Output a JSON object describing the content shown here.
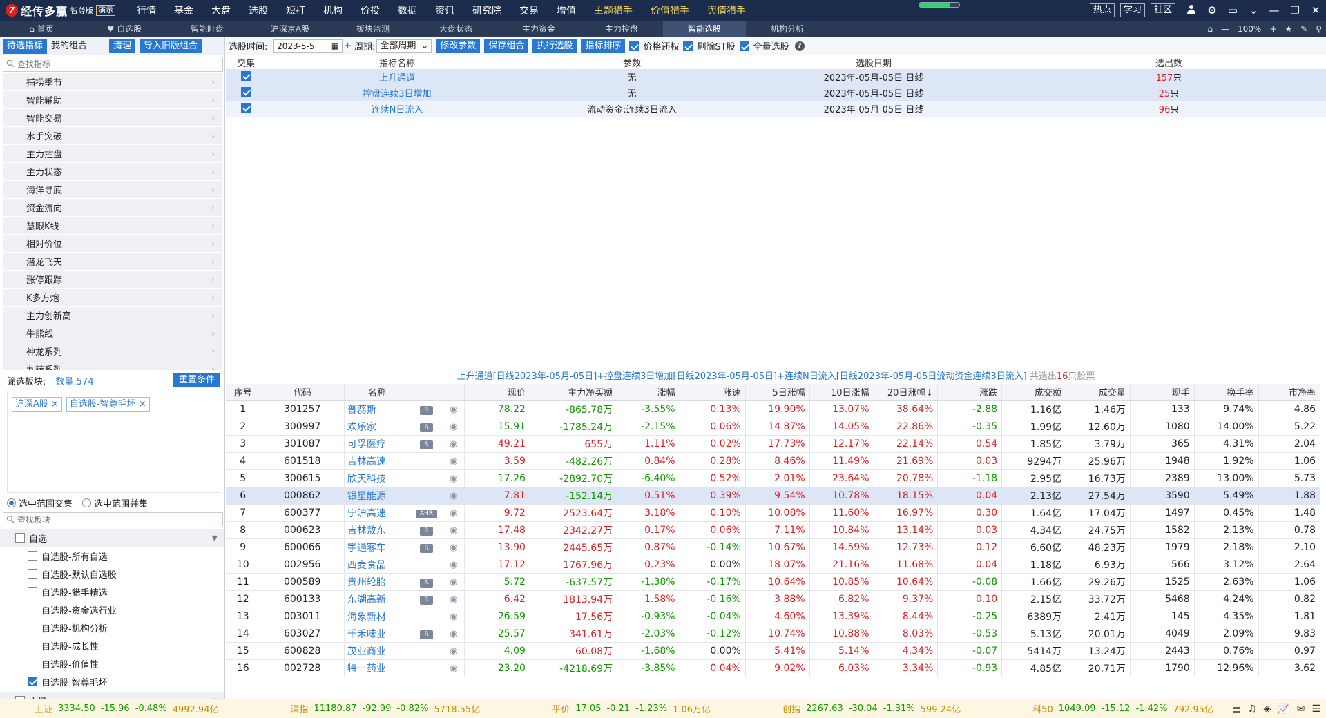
{
  "app": {
    "logo_mark": "7",
    "name": "经传多赢",
    "edition": "智尊版",
    "demo": "演示",
    "download_progress": 0.75
  },
  "menu": [
    "行情",
    "基金",
    "大盘",
    "选股",
    "短打",
    "机构",
    "价投",
    "数据",
    "资讯",
    "研究院",
    "交易",
    "增值"
  ],
  "menu_gold": [
    "主题猎手",
    "价值猎手",
    "舆情猎手"
  ],
  "top_right": {
    "hot": "热点",
    "learn": "学习",
    "community": "社区"
  },
  "tabs": [
    {
      "label": "首页",
      "icon": "home-icon"
    },
    {
      "label": "自选股",
      "icon": "heart-icon"
    },
    {
      "label": "智能盯盘"
    },
    {
      "label": "沪深京A股"
    },
    {
      "label": "板块监测"
    },
    {
      "label": "大盘状态"
    },
    {
      "label": "主力资金"
    },
    {
      "label": "主力控盘"
    },
    {
      "label": "智能选股",
      "active": true
    },
    {
      "label": "机构分析"
    }
  ],
  "tab_right": {
    "zoom": "100%"
  },
  "left": {
    "tab_pending": "待选指标",
    "tab_mine": "我的组合",
    "btn_clear": "清理",
    "btn_import": "导入旧版组合",
    "search_placeholder": "查找指标",
    "indicators": [
      "捕捞季节",
      "智能辅助",
      "智能交易",
      "水手突破",
      "主力控盘",
      "主力状态",
      "海洋寻底",
      "资金流向",
      "慧眼K线",
      "相对价位",
      "潜龙飞天",
      "涨停跟踪",
      "K多方炮",
      "主力创新高",
      "牛熊线",
      "神龙系列",
      "九转系列"
    ],
    "filter_label": "筛选板块:",
    "filter_count": "数量:574",
    "reset_btn": "重置条件",
    "chips": [
      "沪深A股",
      "自选股-智尊毛坯"
    ],
    "radio_intersect": "选中范围交集",
    "radio_union": "选中范围并集",
    "sector_search_placeholder": "查找板块",
    "group_self": "自选",
    "self_items": [
      {
        "label": "自选股-所有自选",
        "checked": false
      },
      {
        "label": "自选股-默认自选股",
        "checked": false
      },
      {
        "label": "自选股-猎手精选",
        "checked": false
      },
      {
        "label": "自选股-资金选行业",
        "checked": false
      },
      {
        "label": "自选股-机构分析",
        "checked": false
      },
      {
        "label": "自选股-成长性",
        "checked": false
      },
      {
        "label": "自选股-价值性",
        "checked": false
      },
      {
        "label": "自选股-智尊毛坯",
        "checked": true
      }
    ],
    "group_market": "市场"
  },
  "toolbar": {
    "time_label": "选股时间:",
    "minus": "-",
    "date": "2023-5-5",
    "plus": "+",
    "period_label": "周期:",
    "period": "全部周期",
    "btn_modify": "修改参数",
    "btn_save": "保存组合",
    "btn_exec": "执行选股",
    "btn_sort": "指标排序",
    "cb_price": "价格还权",
    "cb_st": "剔除ST股",
    "cb_full": "全量选股"
  },
  "ind_table": {
    "headers": [
      "交集",
      "指标名称",
      "参数",
      "选股日期",
      "选出数"
    ],
    "unit": "只",
    "rows": [
      {
        "name": "上升通道",
        "param": "无",
        "date": "2023年-05月-05日 日线",
        "count": "157"
      },
      {
        "name": "控盘连续3日增加",
        "param": "无",
        "date": "2023年-05月-05日 日线",
        "count": "25"
      },
      {
        "name": "连续N日流入",
        "param": "流动资金:连续3日流入",
        "date": "2023年-05月-05日 日线",
        "count": "96"
      }
    ]
  },
  "summary": {
    "text": "上升通道[日线2023年-05月-05日]+控盘连续3日增加[日线2023年-05月-05日]+连续N日流入[日线2023年-05月-05日流动资金连续3日流入]",
    "prefix": "共选出",
    "count": "16",
    "suffix": "只股票"
  },
  "stock_table": {
    "headers": [
      "序号",
      "代码",
      "名称",
      "",
      "",
      "现价",
      "主力净买额",
      "涨幅",
      "涨速",
      "5日涨幅",
      "10日涨幅",
      "20日涨幅↓",
      "涨跌",
      "成交额",
      "成交量",
      "现手",
      "换手率",
      "市净率"
    ],
    "rows": [
      {
        "n": "1",
        "code": "301257",
        "name": "普蕊斯",
        "tag": "R",
        "price": "78.22",
        "net": "-865.78万",
        "chg": "-3.55%",
        "spd": "0.13%",
        "d5": "19.90%",
        "d10": "13.07%",
        "d20": "38.64%",
        "diff": "-2.88",
        "amt": "1.16亿",
        "vol": "1.46万",
        "hand": "133",
        "turn": "9.74%",
        "pb": "4.86"
      },
      {
        "n": "2",
        "code": "300997",
        "name": "欢乐家",
        "tag": "R",
        "price": "15.91",
        "net": "-1785.24万",
        "chg": "-2.15%",
        "spd": "0.06%",
        "d5": "14.87%",
        "d10": "14.05%",
        "d20": "22.86%",
        "diff": "-0.35",
        "amt": "1.99亿",
        "vol": "12.60万",
        "hand": "1080",
        "turn": "14.00%",
        "pb": "5.22"
      },
      {
        "n": "3",
        "code": "301087",
        "name": "可孚医疗",
        "tag": "R",
        "price": "49.21",
        "net": "655万",
        "chg": "1.11%",
        "spd": "0.02%",
        "d5": "17.73%",
        "d10": "12.17%",
        "d20": "22.14%",
        "diff": "0.54",
        "amt": "1.85亿",
        "vol": "3.79万",
        "hand": "365",
        "turn": "4.31%",
        "pb": "2.04"
      },
      {
        "n": "4",
        "code": "601518",
        "name": "吉林高速",
        "tag": "",
        "price": "3.59",
        "net": "-482.26万",
        "chg": "0.84%",
        "spd": "0.28%",
        "d5": "8.46%",
        "d10": "11.49%",
        "d20": "21.69%",
        "diff": "0.03",
        "amt": "9294万",
        "vol": "25.96万",
        "hand": "1948",
        "turn": "1.92%",
        "pb": "1.06"
      },
      {
        "n": "5",
        "code": "300615",
        "name": "欣天科技",
        "tag": "",
        "price": "17.26",
        "net": "-2892.70万",
        "chg": "-6.40%",
        "spd": "0.52%",
        "d5": "2.01%",
        "d10": "23.64%",
        "d20": "20.78%",
        "diff": "-1.18",
        "amt": "2.95亿",
        "vol": "16.73万",
        "hand": "2389",
        "turn": "13.00%",
        "pb": "5.73"
      },
      {
        "n": "6",
        "code": "000862",
        "name": "银星能源",
        "tag": "",
        "price": "7.81",
        "net": "-152.14万",
        "chg": "0.51%",
        "spd": "0.39%",
        "d5": "9.54%",
        "d10": "10.78%",
        "d20": "18.15%",
        "diff": "0.04",
        "amt": "2.13亿",
        "vol": "27.54万",
        "hand": "3590",
        "turn": "5.49%",
        "pb": "1.88",
        "hl": true
      },
      {
        "n": "7",
        "code": "600377",
        "name": "宁沪高速",
        "tag": "AHR",
        "price": "9.72",
        "net": "2523.64万",
        "chg": "3.18%",
        "spd": "0.10%",
        "d5": "10.08%",
        "d10": "11.60%",
        "d20": "16.97%",
        "diff": "0.30",
        "amt": "1.64亿",
        "vol": "17.04万",
        "hand": "1497",
        "turn": "0.45%",
        "pb": "1.48"
      },
      {
        "n": "8",
        "code": "000623",
        "name": "吉林敖东",
        "tag": "R",
        "price": "17.48",
        "net": "2342.27万",
        "chg": "0.17%",
        "spd": "0.06%",
        "d5": "7.11%",
        "d10": "10.84%",
        "d20": "13.14%",
        "diff": "0.03",
        "amt": "4.34亿",
        "vol": "24.75万",
        "hand": "1582",
        "turn": "2.13%",
        "pb": "0.78"
      },
      {
        "n": "9",
        "code": "600066",
        "name": "宇通客车",
        "tag": "R",
        "price": "13.90",
        "net": "2445.65万",
        "chg": "0.87%",
        "spd": "-0.14%",
        "d5": "10.67%",
        "d10": "14.59%",
        "d20": "12.73%",
        "diff": "0.12",
        "amt": "6.60亿",
        "vol": "48.23万",
        "hand": "1979",
        "turn": "2.18%",
        "pb": "2.10"
      },
      {
        "n": "10",
        "code": "002956",
        "name": "西麦食品",
        "tag": "",
        "price": "17.12",
        "net": "1767.96万",
        "chg": "0.23%",
        "spd": "0.00%",
        "d5": "18.07%",
        "d10": "21.16%",
        "d20": "11.68%",
        "diff": "0.04",
        "amt": "1.18亿",
        "vol": "6.93万",
        "hand": "566",
        "turn": "3.12%",
        "pb": "2.64"
      },
      {
        "n": "11",
        "code": "000589",
        "name": "贵州轮胎",
        "tag": "R",
        "price": "5.72",
        "net": "-637.57万",
        "chg": "-1.38%",
        "spd": "-0.17%",
        "d5": "10.64%",
        "d10": "10.85%",
        "d20": "10.64%",
        "diff": "-0.08",
        "amt": "1.66亿",
        "vol": "29.26万",
        "hand": "1525",
        "turn": "2.63%",
        "pb": "1.06"
      },
      {
        "n": "12",
        "code": "600133",
        "name": "东湖高新",
        "tag": "R",
        "price": "6.42",
        "net": "1813.94万",
        "chg": "1.58%",
        "spd": "-0.16%",
        "d5": "3.88%",
        "d10": "6.82%",
        "d20": "9.37%",
        "diff": "0.10",
        "amt": "2.15亿",
        "vol": "33.72万",
        "hand": "5468",
        "turn": "4.24%",
        "pb": "0.82"
      },
      {
        "n": "13",
        "code": "003011",
        "name": "海象新材",
        "tag": "",
        "price": "26.59",
        "net": "17.56万",
        "chg": "-0.93%",
        "spd": "-0.04%",
        "d5": "4.60%",
        "d10": "13.39%",
        "d20": "8.44%",
        "diff": "-0.25",
        "amt": "6389万",
        "vol": "2.41万",
        "hand": "145",
        "turn": "4.35%",
        "pb": "1.81"
      },
      {
        "n": "14",
        "code": "603027",
        "name": "千禾味业",
        "tag": "R",
        "price": "25.57",
        "net": "341.61万",
        "chg": "-2.03%",
        "spd": "-0.12%",
        "d5": "10.74%",
        "d10": "10.88%",
        "d20": "8.03%",
        "diff": "-0.53",
        "amt": "5.13亿",
        "vol": "20.01万",
        "hand": "4049",
        "turn": "2.09%",
        "pb": "9.83"
      },
      {
        "n": "15",
        "code": "600828",
        "name": "茂业商业",
        "tag": "",
        "price": "4.09",
        "net": "60.08万",
        "chg": "-1.68%",
        "spd": "0.00%",
        "d5": "5.41%",
        "d10": "5.14%",
        "d20": "4.34%",
        "diff": "-0.07",
        "amt": "5414万",
        "vol": "13.24万",
        "hand": "2443",
        "turn": "0.76%",
        "pb": "0.97"
      },
      {
        "n": "16",
        "code": "002728",
        "name": "特一药业",
        "tag": "",
        "price": "23.20",
        "net": "-4218.69万",
        "chg": "-3.85%",
        "spd": "0.04%",
        "d5": "9.02%",
        "d10": "6.03%",
        "d20": "3.34%",
        "diff": "-0.93",
        "amt": "4.85亿",
        "vol": "20.71万",
        "hand": "1790",
        "turn": "12.96%",
        "pb": "3.62"
      }
    ]
  },
  "status_bar": [
    {
      "name": "上证",
      "value": "3334.50",
      "chg": "-15.96",
      "pct": "-0.48%",
      "amt": "4992.94亿"
    },
    {
      "name": "深指",
      "value": "11180.87",
      "chg": "-92.99",
      "pct": "-0.82%",
      "amt": "5718.55亿"
    },
    {
      "name": "平价",
      "value": "17.05",
      "chg": "-0.21",
      "pct": "-1.23%",
      "amt": "1.06万亿"
    },
    {
      "name": "创指",
      "value": "2267.63",
      "chg": "-30.04",
      "pct": "-1.31%",
      "amt": "599.24亿"
    },
    {
      "name": "科50",
      "value": "1049.09",
      "chg": "-15.12",
      "pct": "-1.42%",
      "amt": "792.95亿"
    }
  ],
  "colors": {
    "accent": "#2878d2",
    "up": "#e51d1d",
    "down": "#119900",
    "titlebar": "#1b2c4c"
  }
}
